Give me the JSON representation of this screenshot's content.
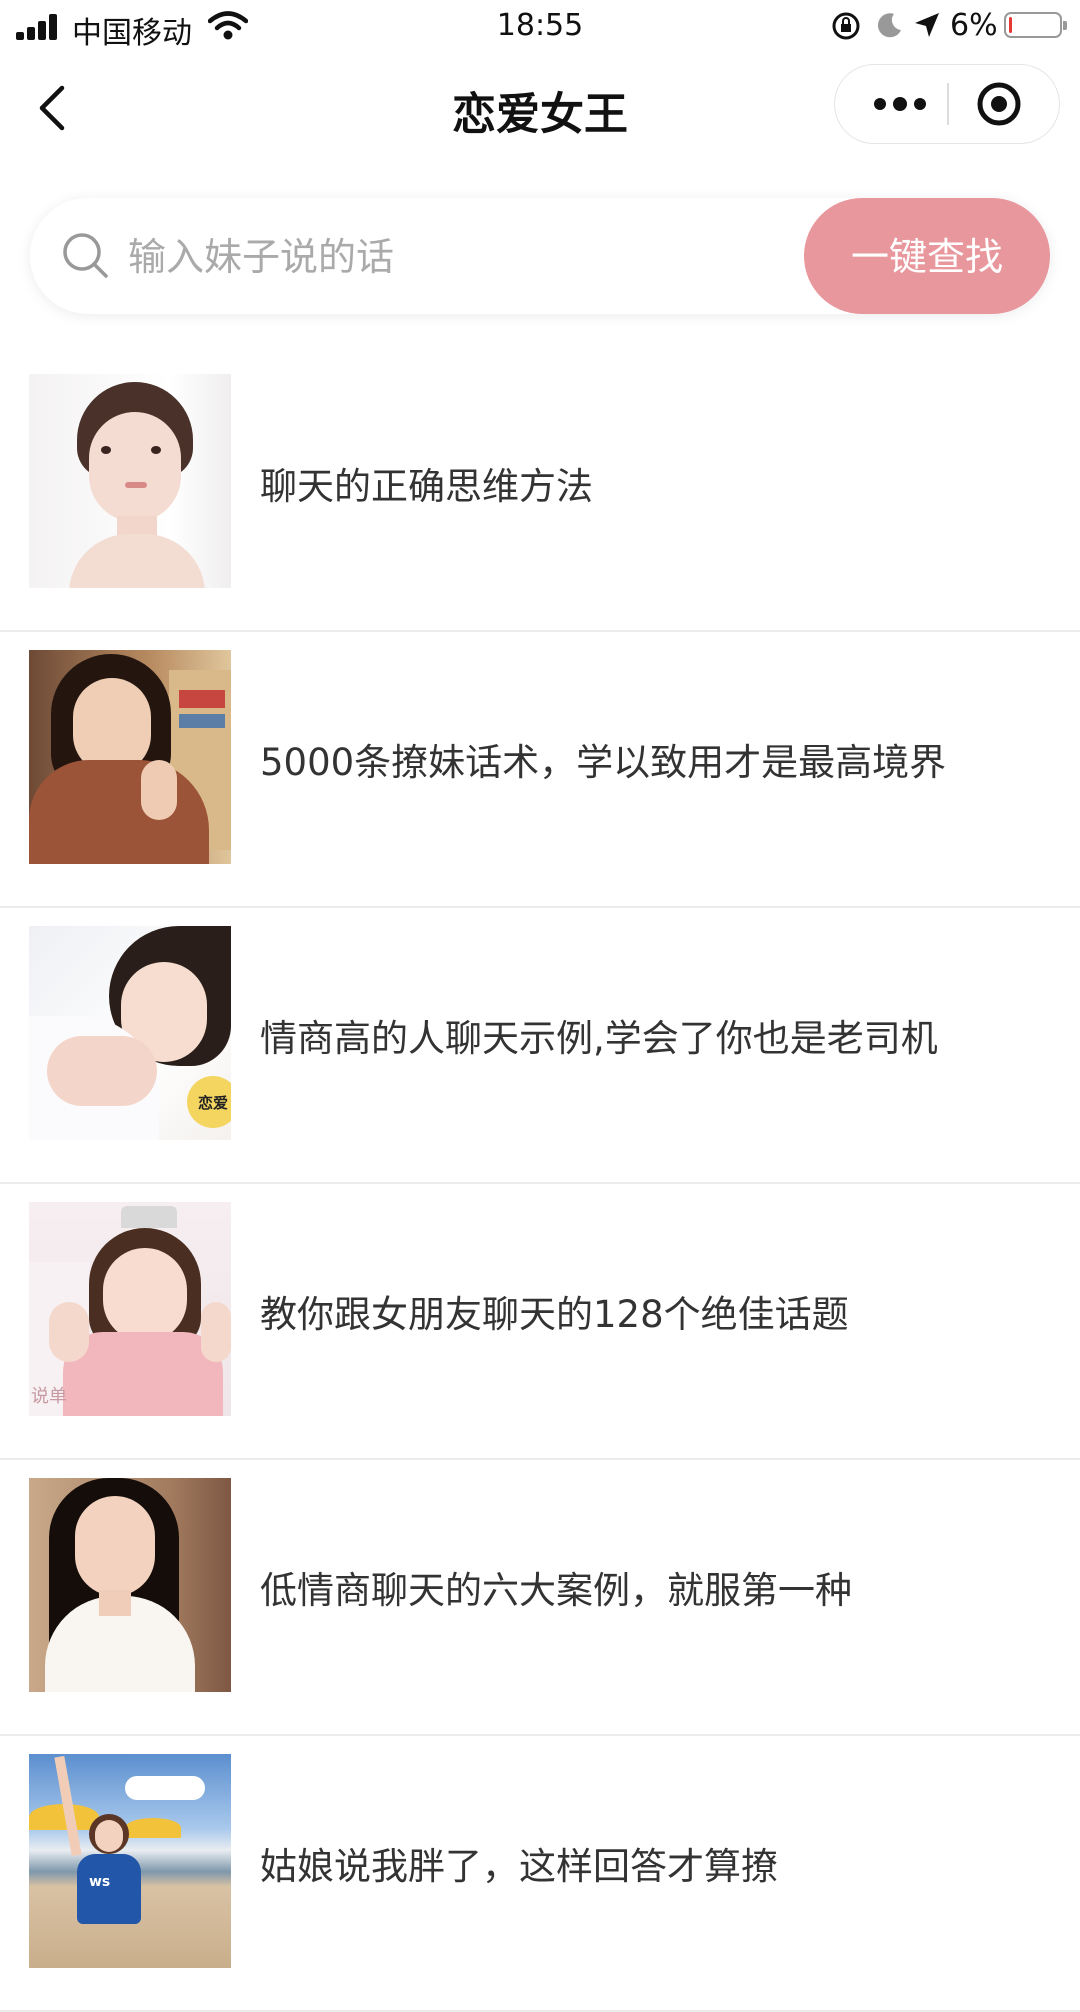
{
  "status_bar": {
    "carrier": "中国移动",
    "time": "18:55",
    "battery_percent": "6%",
    "battery_level": 0.06
  },
  "nav": {
    "title": "恋爱女王"
  },
  "search": {
    "placeholder": "输入妹子说的话",
    "button_label": "一键查找"
  },
  "articles": [
    {
      "title": "聊天的正确思维方法"
    },
    {
      "title": "5000条撩妹话术，学以致用才是最高境界"
    },
    {
      "title": "情商高的人聊天示例,学会了你也是老司机"
    },
    {
      "title": "教你跟女朋友聊天的128个绝佳话题"
    },
    {
      "title": "低情商聊天的六大案例，就服第一种"
    },
    {
      "title": "姑娘说我胖了，这样回答才算撩"
    }
  ],
  "thumb_badges": {
    "badge_3": "恋爱",
    "badge_4": "说单",
    "badge_6": "ws"
  },
  "colors": {
    "accent": "#e8979c",
    "divider": "#ececec"
  }
}
